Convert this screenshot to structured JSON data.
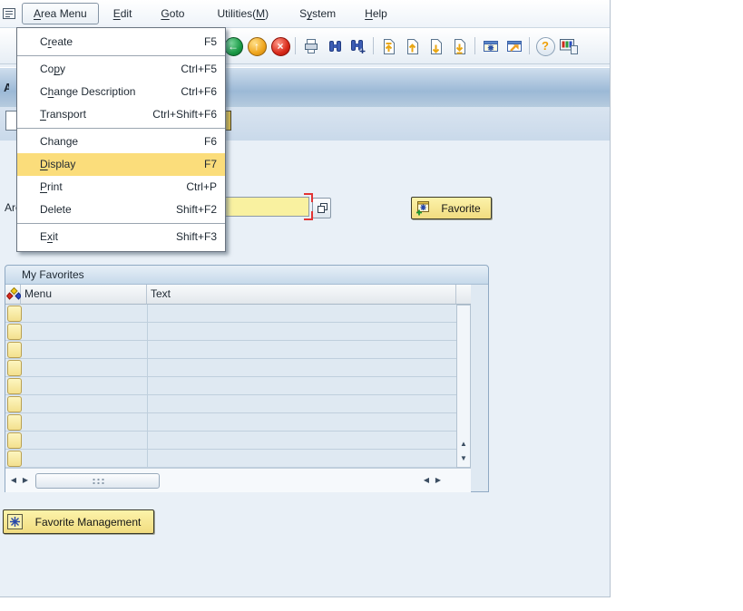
{
  "titlebar": {
    "visible_fragment": "A"
  },
  "menubar": {
    "items": [
      {
        "pre": "",
        "key": "A",
        "post": "rea Menu",
        "open": true
      },
      {
        "pre": "",
        "key": "E",
        "post": "dit"
      },
      {
        "pre": "",
        "key": "G",
        "post": "oto"
      },
      {
        "pre": "Utilities(",
        "key": "M",
        "post": ")"
      },
      {
        "pre": "S",
        "key": "y",
        "post": "stem"
      },
      {
        "pre": "",
        "key": "H",
        "post": "elp"
      }
    ]
  },
  "dropdown": {
    "items": [
      {
        "pre": "C",
        "key": "r",
        "post": "eate",
        "shortcut": "F5"
      },
      {
        "pre": "Co",
        "key": "p",
        "post": "y",
        "shortcut": "Ctrl+F5"
      },
      {
        "pre": "C",
        "key": "h",
        "post": "ange Description",
        "shortcut": "Ctrl+F6"
      },
      {
        "pre": "",
        "key": "T",
        "post": "ransport",
        "shortcut": "Ctrl+Shift+F6"
      },
      {
        "pre": "Change",
        "key": "",
        "post": "",
        "shortcut": "F6"
      },
      {
        "pre": "",
        "key": "D",
        "post": "isplay",
        "shortcut": "F7",
        "highlighted": true
      },
      {
        "pre": "",
        "key": "P",
        "post": "rint",
        "shortcut": "Ctrl+P"
      },
      {
        "pre": "Delete",
        "key": "",
        "post": "",
        "shortcut": "Shift+F2"
      },
      {
        "pre": "E",
        "key": "x",
        "post": "it",
        "shortcut": "Shift+F3"
      }
    ]
  },
  "toolbar": {
    "icons": [
      {
        "name": "back-icon",
        "glyph": "←"
      },
      {
        "name": "exit-icon",
        "glyph": "↑"
      },
      {
        "name": "cancel-icon",
        "glyph": "×"
      },
      {
        "name": "print-icon"
      },
      {
        "name": "find-icon"
      },
      {
        "name": "find-next-icon"
      },
      {
        "name": "first-page-icon"
      },
      {
        "name": "previous-page-icon"
      },
      {
        "name": "next-page-icon"
      },
      {
        "name": "last-page-icon"
      },
      {
        "name": "new-session-icon"
      },
      {
        "name": "create-shortcut-icon"
      },
      {
        "name": "help-icon",
        "glyph": "?"
      },
      {
        "name": "customize-layout-icon"
      }
    ]
  },
  "content": {
    "area_menu_label": "Area Menu",
    "favorite_button_label": "Favorite",
    "favorite_management_label": "Favorite Management",
    "favorites_panel": {
      "title": "My Favorites",
      "columns": [
        "Menu",
        "Text"
      ],
      "rows": [
        {},
        {},
        {},
        {},
        {},
        {},
        {},
        {},
        {}
      ]
    }
  },
  "colors": {
    "menu_highlight": "#fbdd7b",
    "field_yellow": "#f9f1a0",
    "button_yellow": "#f1dc80",
    "titlebar_blue": "#a8c2dc",
    "row_blue": "#dfe9f2",
    "focus_red": "#e23434"
  }
}
